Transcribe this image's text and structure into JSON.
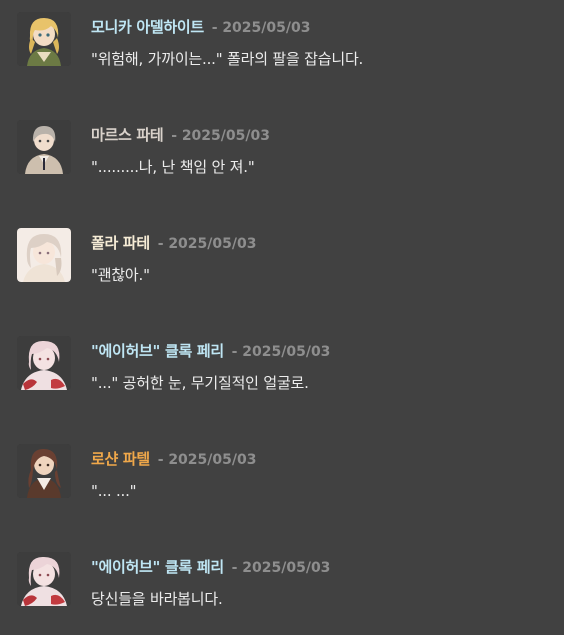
{
  "messages": [
    {
      "speaker": "모니카 아델하이트",
      "speaker_color": "#bfe6f4",
      "separator": "-",
      "date": "2025/05/03",
      "text": "\"위험해, 가까이는...\" 폴라의 팔을 잡습니다.",
      "avatar_icon": "blonde-character-avatar-icon"
    },
    {
      "speaker": "마르스 파테",
      "speaker_color": "#d9d2cb",
      "separator": "-",
      "date": "2025/05/03",
      "text": "\".........나, 난 책임 안 져.\"",
      "avatar_icon": "grey-haired-character-avatar-icon"
    },
    {
      "speaker": "폴라 파테",
      "speaker_color": "#f6ecd6",
      "separator": "-",
      "date": "2025/05/03",
      "text": "\"괜찮아.\"",
      "avatar_icon": "pale-haired-character-avatar-icon"
    },
    {
      "speaker": "\"에이허브\" 클록 페리",
      "speaker_color": "#bfe6f4",
      "separator": "-",
      "date": "2025/05/03",
      "text": "\"...\" 공허한 눈, 무기질적인 얼굴로.",
      "avatar_icon": "red-stained-character-avatar-icon"
    },
    {
      "speaker": "로샨 파텔",
      "speaker_color": "#f0a84a",
      "separator": "-",
      "date": "2025/05/03",
      "text": "\"... ...\"",
      "avatar_icon": "brown-haired-character-avatar-icon"
    },
    {
      "speaker": "\"에이허브\" 클록 페리",
      "speaker_color": "#bfe6f4",
      "separator": "-",
      "date": "2025/05/03",
      "text": "당신들을 바라봅니다.",
      "avatar_icon": "red-stained-character-avatar-icon"
    }
  ]
}
